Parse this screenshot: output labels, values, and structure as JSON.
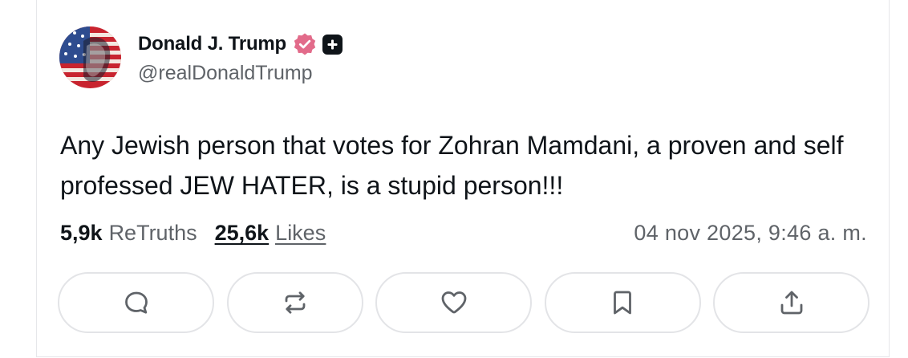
{
  "post": {
    "display_name": "Donald J. Trump",
    "handle": "@realDonaldTrump",
    "text": "Any Jewish person that votes for Zohran Mamdani, a proven and self professed JEW HATER, is a stupid person!!!",
    "retruths_count": "5,9k",
    "retruths_label": "ReTruths",
    "likes_count": "25,6k",
    "likes_label": "Likes",
    "timestamp": "04 nov 2025, 9:46 a. m."
  },
  "icons": {
    "avatar": "flag-face-avatar",
    "verified": "verified-badge-icon",
    "plus": "plus-badge-icon",
    "reply": "reply-icon",
    "repost": "retruth-icon",
    "like": "heart-icon",
    "bookmark": "bookmark-icon",
    "share": "share-icon"
  },
  "colors": {
    "verified_badge": "#e26b8a",
    "plus_badge": "#0f1419",
    "text_primary": "#0f1419",
    "text_secondary": "#5f6368",
    "button_border": "#e3e4e7"
  }
}
